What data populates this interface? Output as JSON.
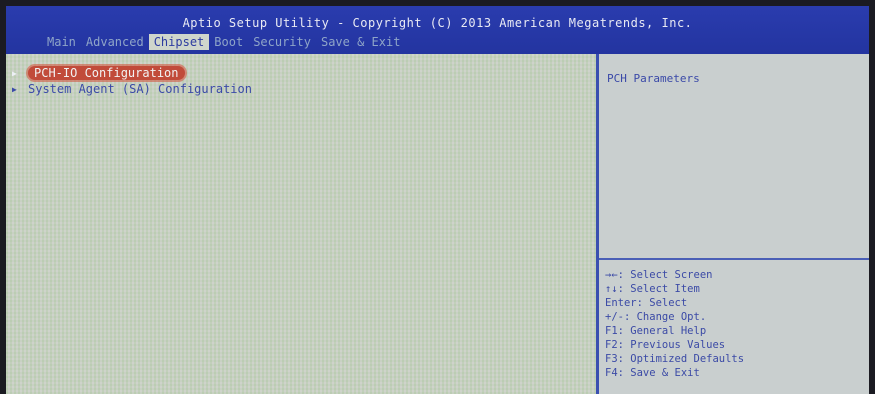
{
  "header": {
    "title": "Aptio Setup Utility - Copyright (C) 2013 American Megatrends, Inc."
  },
  "tabs": [
    {
      "label": "Main"
    },
    {
      "label": "Advanced"
    },
    {
      "label": "Chipset",
      "active": true
    },
    {
      "label": "Boot"
    },
    {
      "label": "Security"
    },
    {
      "label": "Save & Exit"
    }
  ],
  "menu": {
    "items": [
      {
        "label": "PCH-IO Configuration",
        "selected": true
      },
      {
        "label": "System Agent (SA) Configuration"
      }
    ],
    "arrow_icon": "triangle-right-icon"
  },
  "help": {
    "title": "PCH Parameters",
    "keys": [
      "→←: Select Screen",
      "↑↓: Select Item",
      "Enter: Select",
      "+/-: Change Opt.",
      "F1: General Help",
      "F2: Previous Values",
      "F3: Optimized Defaults",
      "F4: Save & Exit"
    ]
  },
  "colors": {
    "header_bg": "#2334a0",
    "body_bg": "#c8d2c0",
    "text": "#3b4aa8",
    "highlight": "#c14b3a"
  }
}
